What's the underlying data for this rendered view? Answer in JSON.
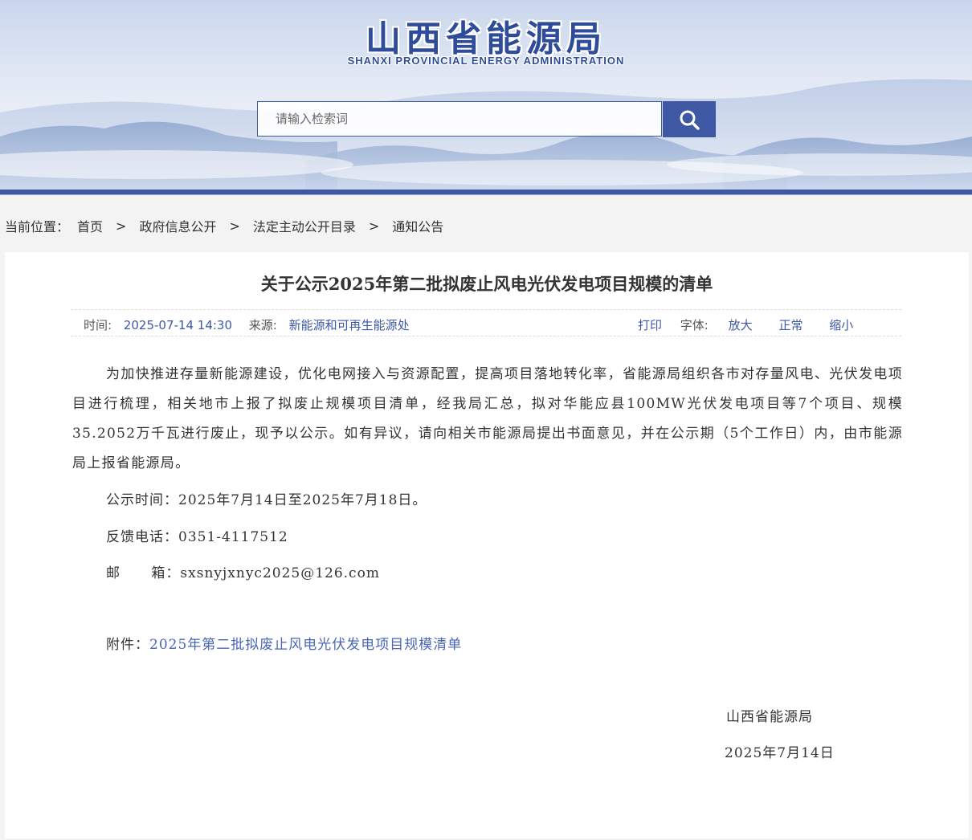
{
  "header": {
    "title": "山西省能源局",
    "subtitle": "SHANXI PROVINCIAL ENERGY ADMINISTRATION"
  },
  "search": {
    "placeholder": "请输入检索词",
    "button_icon": "search-icon"
  },
  "breadcrumb": {
    "label": "当前位置：",
    "items": [
      "首页",
      "政府信息公开",
      "法定主动公开目录",
      "通知公告"
    ],
    "separator": ">"
  },
  "article": {
    "title": "关于公示2025年第二批拟废止风电光伏发电项目规模的清单",
    "meta": {
      "time_label": "时间:",
      "time": "2025-07-14 14:30",
      "source_label": "来源:",
      "source": "新能源和可再生能源处",
      "print": "打印",
      "font_label": "字体:",
      "font_large": "放大",
      "font_normal": "正常",
      "font_small": "缩小"
    },
    "paragraph": "为加快推进存量新能源建设，优化电网接入与资源配置，提高项目落地转化率，省能源局组织各市对存量风电、光伏发电项目进行梳理，相关地市上报了拟废止规模项目清单，经我局汇总，拟对华能应县100MW光伏发电项目等7个项目、规模35.2052万千瓦进行废止，现予以公示。如有异议，请向相关市能源局提出书面意见，并在公示期（5个工作日）内，由市能源局上报省能源局。",
    "period": "公示时间：2025年7月14日至2025年7月18日。",
    "phone": "反馈电话：0351-4117512",
    "email": "邮      箱：sxsnyjxnyc2025@126.com",
    "attachment_label": "附件：",
    "attachment_link": "2025年第二批拟废止风电光伏发电项目规模清单",
    "signature_org": "山西省能源局",
    "signature_date": "2025年7月14日"
  },
  "colors": {
    "brand": "#3e58a3",
    "link": "#4a66b5",
    "page_bg": "#f3f3f3"
  }
}
